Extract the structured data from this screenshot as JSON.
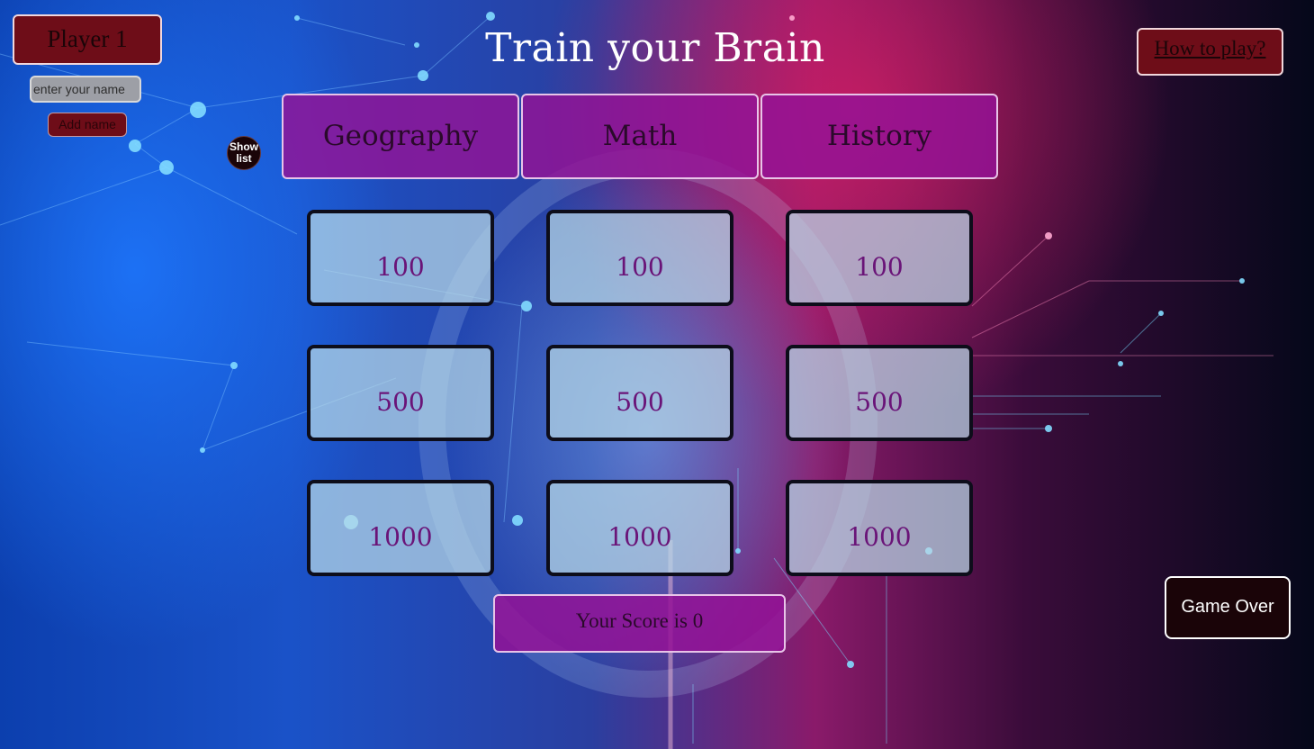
{
  "app": {
    "title": "Train your Brain"
  },
  "player": {
    "label": "Player 1",
    "name_placeholder": "enter your name",
    "add_name_label": "Add name",
    "show_list_label_line1": "Show",
    "show_list_label_line2": "list"
  },
  "header": {
    "how_to_play_label": "How to play?"
  },
  "categories": [
    {
      "label": "Geography"
    },
    {
      "label": "Math"
    },
    {
      "label": "History"
    }
  ],
  "board": {
    "rows": [
      {
        "values": [
          "100",
          "100",
          "100"
        ]
      },
      {
        "values": [
          "500",
          "500",
          "500"
        ]
      },
      {
        "values": [
          "1000",
          "1000",
          "1000"
        ]
      }
    ]
  },
  "score": {
    "text": "Your Score is 0",
    "value": 0
  },
  "game_over_label": "Game Over",
  "colors": {
    "accent_purple": "#9412a0",
    "button_maroon": "#6e0d18",
    "tile_bg": "#b8dae8",
    "tile_text": "#6a1478"
  }
}
